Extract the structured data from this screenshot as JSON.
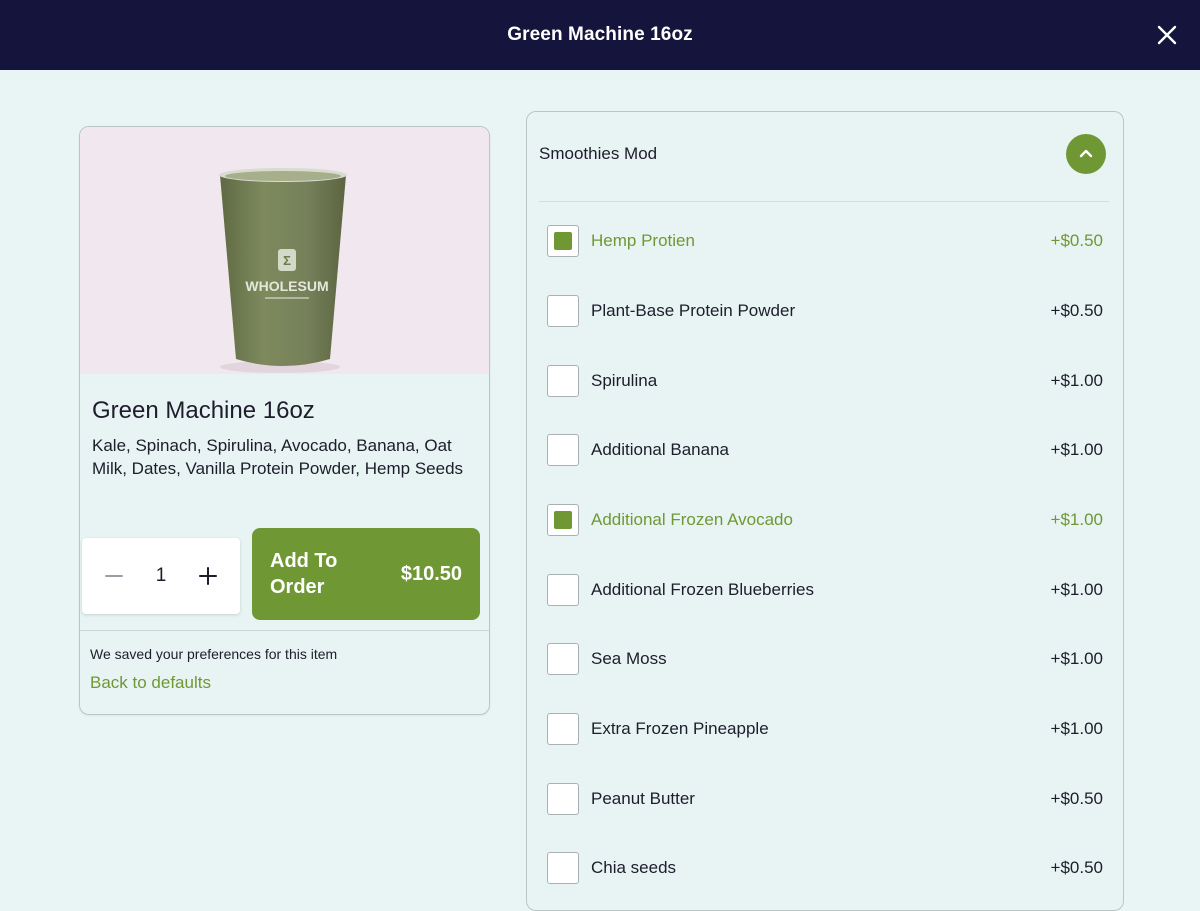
{
  "header": {
    "title": "Green Machine 16oz"
  },
  "item": {
    "name": "Green Machine 16oz",
    "description": "Kale, Spinach, Spirulina, Avocado, Banana, Oat Milk, Dates, Vanilla Protein Powder, Hemp Seeds",
    "image_brand": "WHOLESUM",
    "quantity": "1",
    "add_label": "Add To Order",
    "add_price": "$10.50",
    "saved_text": "We saved your preferences for this item",
    "defaults_link": "Back to defaults"
  },
  "modifiers": {
    "title": "Smoothies Mod",
    "options": [
      {
        "label": "Hemp Protien",
        "price": "+$0.50",
        "checked": true
      },
      {
        "label": "Plant-Base Protein Powder",
        "price": "+$0.50",
        "checked": false
      },
      {
        "label": "Spirulina",
        "price": "+$1.00",
        "checked": false
      },
      {
        "label": "Additional Banana",
        "price": "+$1.00",
        "checked": false
      },
      {
        "label": "Additional Frozen Avocado",
        "price": "+$1.00",
        "checked": true
      },
      {
        "label": "Additional Frozen Blueberries",
        "price": "+$1.00",
        "checked": false
      },
      {
        "label": "Sea Moss",
        "price": "+$1.00",
        "checked": false
      },
      {
        "label": "Extra Frozen Pineapple",
        "price": "+$1.00",
        "checked": false
      },
      {
        "label": "Peanut Butter",
        "price": "+$0.50",
        "checked": false
      },
      {
        "label": "Chia seeds",
        "price": "+$0.50",
        "checked": false
      }
    ]
  },
  "colors": {
    "header_bg": "#15143c",
    "accent": "#6f9834",
    "page_bg": "#e9f4f4"
  },
  "icons": {
    "close": "close-icon",
    "minus": "minus-icon",
    "plus": "plus-icon",
    "collapse": "chevron-up-icon"
  }
}
